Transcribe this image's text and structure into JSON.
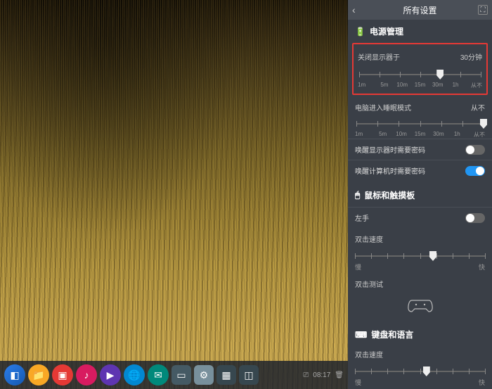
{
  "panel": {
    "title": "所有设置",
    "sections": {
      "power": {
        "title": "电源管理",
        "displayOff": {
          "label": "关闭显示器于",
          "value": "30分钟",
          "ticks": [
            "1m",
            "5m",
            "10m",
            "15m",
            "30m",
            "1h",
            "从不"
          ],
          "thumbIndex": 4
        },
        "sleep": {
          "label": "电脑进入睡眠模式",
          "value": "从不",
          "ticks": [
            "1m",
            "5m",
            "10m",
            "15m",
            "30m",
            "1h",
            "从不"
          ],
          "thumbIndex": 6
        },
        "wakeDisplayPwd": {
          "label": "唤醒显示器时需要密码",
          "on": false
        },
        "wakeComputerPwd": {
          "label": "唤醒计算机时需要密码",
          "on": true
        }
      },
      "mouse": {
        "title": "鼠标和触摸板",
        "leftHand": {
          "label": "左手",
          "on": false
        },
        "dblClickSpeed": {
          "label": "双击速度",
          "min": "慢",
          "max": "快",
          "thumbPct": 60
        },
        "dblClickTest": {
          "label": "双击测试"
        }
      },
      "keyboard": {
        "title": "键盘和语言",
        "repeatSpeed": {
          "label": "双击速度",
          "min": "慢",
          "max": "快",
          "thumbPct": 55
        }
      }
    }
  }
}
